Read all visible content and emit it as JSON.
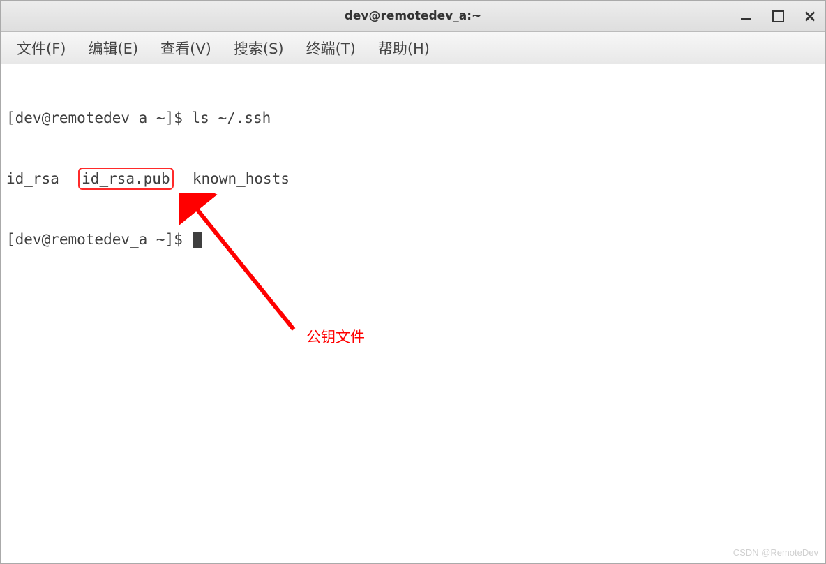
{
  "window": {
    "title": "dev@remotedev_a:~"
  },
  "menu": {
    "file": "文件(F)",
    "edit": "编辑(E)",
    "view": "查看(V)",
    "search": "搜索(S)",
    "terminal": "终端(T)",
    "help": "帮助(H)"
  },
  "terminal": {
    "prompt1_pre": "[dev@remotedev_a ~]$ ",
    "command1": "ls ~/.ssh",
    "output_file1": "id_rsa",
    "output_file2": "id_rsa.pub",
    "output_file3": "known_hosts",
    "prompt2": "[dev@remotedev_a ~]$ "
  },
  "annotation": {
    "label": "公钥文件"
  },
  "watermark": "CSDN @RemoteDev"
}
